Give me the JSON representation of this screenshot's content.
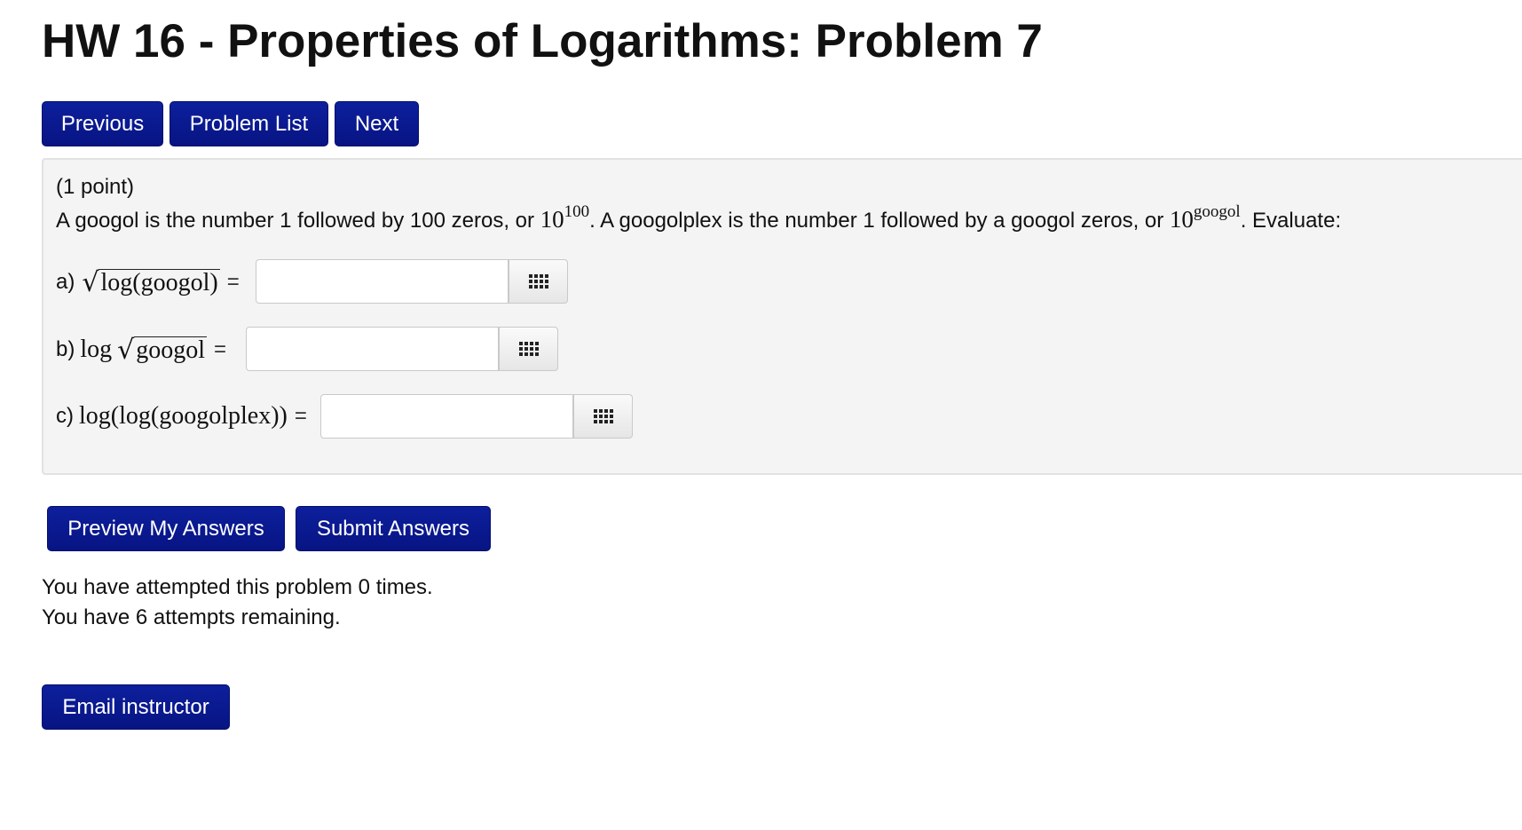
{
  "page": {
    "title": "HW 16 - Properties of Logarithms: Problem 7"
  },
  "nav": {
    "previous": "Previous",
    "problem_list": "Problem List",
    "next": "Next"
  },
  "problem": {
    "points": "(1 point)",
    "statement": {
      "part1": "A googol is the number 1 followed by 100 zeros, or ",
      "base1": "10",
      "exp1": "100",
      "part2": ". A googolplex is the number 1 followed by a googol zeros, or ",
      "base2": "10",
      "exp2": "googol",
      "part3": ". Evaluate:"
    },
    "parts": [
      {
        "label": "a)",
        "radicand": "log(googol)",
        "equals": "=",
        "value": "",
        "palette_icon": "grid-icon"
      },
      {
        "label": "b)",
        "prefix": "log",
        "radicand": "googol",
        "equals": "=",
        "value": "",
        "palette_icon": "grid-icon"
      },
      {
        "label": "c)",
        "expr": "log(log(googolplex))",
        "equals": "=",
        "value": "",
        "palette_icon": "grid-icon"
      }
    ]
  },
  "actions": {
    "preview": "Preview My Answers",
    "submit": "Submit Answers",
    "email": "Email instructor"
  },
  "status": {
    "attempted": "You have attempted this problem 0 times.",
    "remaining": "You have 6 attempts remaining."
  },
  "colors": {
    "button": "#0b1a93",
    "panel": "#f4f4f4"
  }
}
